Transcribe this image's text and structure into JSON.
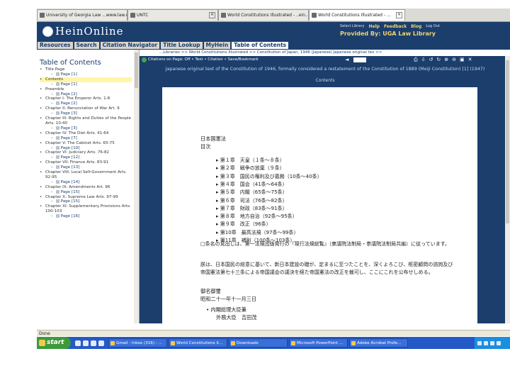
{
  "browser": {
    "tabs": [
      {
        "label": "University of Georgia Law ...www.law.u...",
        "active": false
      },
      {
        "label": "UNTC",
        "active": false
      },
      {
        "label": "World Constitutions Illustrated - ..ein...",
        "active": false
      },
      {
        "label": "World Constitutions Illustrated - ...",
        "active": true
      }
    ],
    "status": "Done"
  },
  "header": {
    "logo": "HeinOnline",
    "top_links": [
      "Select Library",
      "Help",
      "Feedback",
      "Blog",
      "Log Out"
    ],
    "provided_by": "Provided By: UGA Law Library",
    "nav": [
      "Resources",
      "Search",
      "Citation Navigator",
      "Title Lookup",
      "MyHein",
      "Table of Contents"
    ],
    "nav_current": 5
  },
  "toc": {
    "title": "Table of Contents",
    "items": [
      {
        "label": "Title Page",
        "page": "Page [1]",
        "highlight": false,
        "bullet": true
      },
      {
        "label": "Contents",
        "page": "Page [1]",
        "highlight": true,
        "bullet": true
      },
      {
        "label": "Preamble",
        "page": "Page [2]",
        "highlight": false,
        "bullet": true
      },
      {
        "label": "Chapter I: The Emperor Arts. 1-8",
        "page": "Page [2]",
        "highlight": false,
        "bullet": true
      },
      {
        "label": "Chapter II: Renunciation of War Art. 9",
        "page": "Page [3]",
        "highlight": false,
        "bullet": true
      },
      {
        "label": "Chapter III: Rights and Duties of the People Arts. 10-40",
        "page": "Page [3]",
        "highlight": false,
        "bullet": true
      },
      {
        "label": "Chapter IV: The Diet Arts. 41-64",
        "page": "Page [7]",
        "highlight": false,
        "bullet": true
      },
      {
        "label": "Chapter V: The Cabinet Arts. 65-75",
        "page": "Page [10]",
        "highlight": false,
        "bullet": true
      },
      {
        "label": "Chapter VI: Judiciary Arts. 76-82",
        "page": "Page [12]",
        "highlight": false,
        "bullet": true
      },
      {
        "label": "Chapter VII: Finance Arts. 83-91",
        "page": "Page [13]",
        "highlight": false,
        "bullet": true
      },
      {
        "label": "Chapter VIII: Local Self-Government Arts. 92-95",
        "page": "Page [14]",
        "highlight": false,
        "bullet": true
      },
      {
        "label": "Chapter IX: Amendments Art. 96",
        "page": "Page [15]",
        "highlight": false,
        "bullet": true
      },
      {
        "label": "Chapter X: Supreme Law Arts. 97-99",
        "page": "Page [15]",
        "highlight": false,
        "bullet": true
      },
      {
        "label": "Chapter XI: Supplementary Provisions Arts. 100-103",
        "page": "Page [16]",
        "highlight": false,
        "bullet": true
      }
    ]
  },
  "viewer": {
    "breadcrumb": "...Libraries >> World Constitutions Illustrated >> Constitution of Japan, 1946 (Japanese) Japanese original tex >>",
    "toolbar_text": "Citations on Page: Off  •  Text  •  Citation  •  Save/Bookmark",
    "heading": "Japanese original text of the Constitution of 1946, formally considered a restatement of the Constitution of 1889 (Meiji Constitution) [1] (1947)",
    "subheading": "Contents",
    "toolbar_icons": [
      "print-icon",
      "download-icon",
      "rotate-left-icon",
      "rotate-right-icon",
      "zoom-in-icon",
      "zoom-out-icon",
      "fit-icon",
      "close-icon"
    ]
  },
  "document": {
    "title": "日本国憲法",
    "contents_label": "目次",
    "chapters": [
      "第１章　天皇（１条～８条）",
      "第２章　戦争の放棄（９条）",
      "第３章　国民の権利及び義務（10条～40条）",
      "第４章　国会（41条～64条）",
      "第５章　内閣（65条～75条）",
      "第６章　司法（76条～82条）",
      "第７章　財政（83条～91条）",
      "第８章　地方自治（92条～95条）",
      "第９章　改正（96条）",
      "第10章　最高法規（97条～99条）",
      "第11章　補則（100条～103条）"
    ],
    "note": "□条名の見出しは、第一法規出版発行の『現行法規総覧』（衆議院法制局・参議院法制局共編）に従っています。",
    "preamble": "朕は、日本国民の総意に基いて、新日本建設の礎が、定まるに至つたことを、深くよろこび、枢密顧問の諮詢及び帝国憲法第七十三条による帝国議会の議決を経た帝国憲法の改正を裁可し、ここにこれを公布せしめる。",
    "signature": "御名御璽",
    "date": "昭和二十一年十一月三日",
    "minister_heading": "内閣総理大臣兼",
    "minister_line": "外務大臣　吉田茂"
  },
  "taskbar": {
    "start": "start",
    "tasks": [
      "Gmail - Inbox (316) - ...",
      "World Constitutions Il...",
      "Downloads",
      "Microsoft PowerPoint ...",
      "Adobe Acrobat Profe..."
    ],
    "time": ""
  }
}
